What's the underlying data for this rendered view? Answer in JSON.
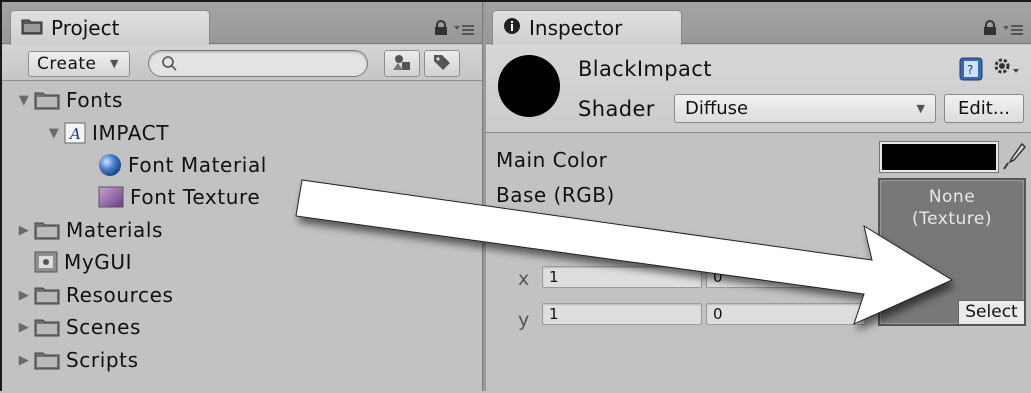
{
  "project": {
    "tab_label": "Project",
    "create_label": "Create",
    "search_placeholder": "",
    "tree": [
      {
        "label": "Fonts",
        "depth": 0,
        "expanded": true,
        "icon": "folder-icon"
      },
      {
        "label": "IMPACT",
        "depth": 1,
        "expanded": true,
        "icon": "font-asset-icon"
      },
      {
        "label": "Font Material",
        "depth": 2,
        "icon": "material-sphere-icon"
      },
      {
        "label": "Font Texture",
        "depth": 2,
        "icon": "texture-icon"
      },
      {
        "label": "Materials",
        "depth": 0,
        "expanded": false,
        "icon": "folder-icon"
      },
      {
        "label": "MyGUI",
        "depth": 0,
        "icon": "script-asset-icon"
      },
      {
        "label": "Resources",
        "depth": 0,
        "expanded": false,
        "icon": "folder-icon"
      },
      {
        "label": "Scenes",
        "depth": 0,
        "expanded": false,
        "icon": "folder-icon"
      },
      {
        "label": "Scripts",
        "depth": 0,
        "expanded": false,
        "icon": "folder-icon"
      }
    ]
  },
  "inspector": {
    "tab_label": "Inspector",
    "material_name": "BlackImpact",
    "shader_label": "Shader",
    "shader_value": "Diffuse",
    "edit_label": "Edit...",
    "main_color_label": "Main Color",
    "main_color_value": "#000000",
    "base_label": "Base (RGB)",
    "texture_none": "None",
    "texture_kind": "(Texture)",
    "select_label": "Select",
    "tiling_x_label": "x",
    "tiling_y_label": "y",
    "tiling_x": "1",
    "tiling_y": "1",
    "offset_x": "0",
    "offset_y": "0"
  }
}
